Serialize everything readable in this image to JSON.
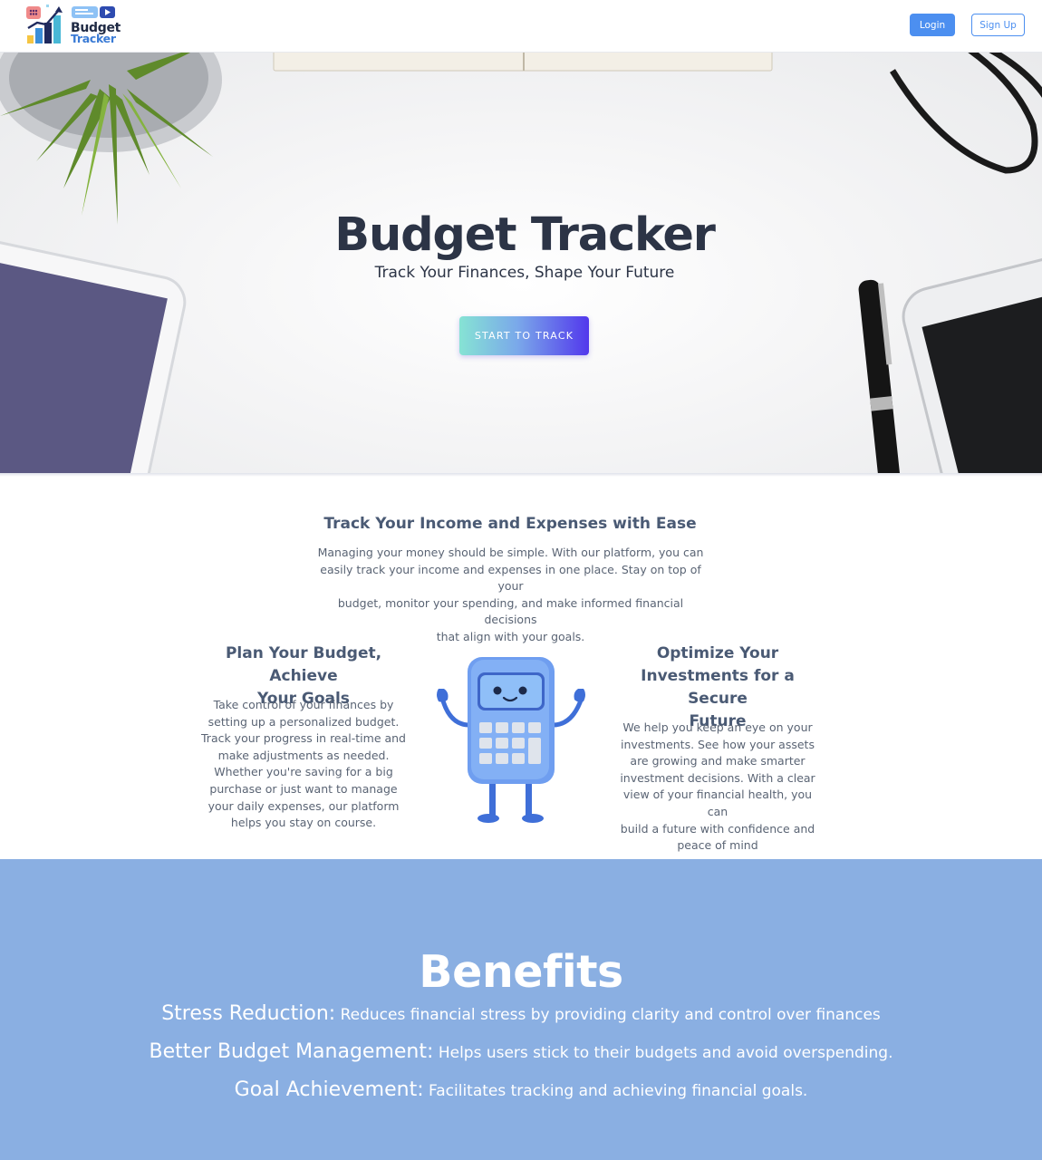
{
  "brand": {
    "line1": "Budget",
    "line2": "Tracker"
  },
  "header": {
    "login_label": "Login",
    "signup_label": "Sign Up"
  },
  "hero": {
    "title": "Budget Tracker",
    "subtitle": "Track Your Finances, Shape Your Future",
    "cta_label": "START TO TRACK"
  },
  "intro": {
    "heading": "Track Your Income and Expenses with Ease",
    "lines": [
      "Managing your money should be simple. With our platform, you can",
      "easily track your income and expenses in one place. Stay on top of your",
      "budget, monitor your spending, and make informed financial decisions",
      "that align with your goals."
    ]
  },
  "plan": {
    "heading_lines": [
      "Plan Your Budget, Achieve",
      "Your Goals"
    ],
    "lines": [
      "Take control of your finances by",
      "setting up a personalized budget.",
      "Track your progress in real-time and",
      "make adjustments as needed.",
      "Whether you're saving for a big",
      "purchase or just want to manage",
      "your daily expenses, our platform",
      "helps you stay on course."
    ]
  },
  "invest": {
    "heading_lines": [
      "Optimize Your",
      "Investments for a Secure",
      "Future"
    ],
    "lines": [
      "We help you keep an eye on your",
      "investments. See how your assets",
      "are growing and make smarter",
      "investment decisions. With a clear",
      "view of your financial health, you can",
      "build a future with confidence and",
      "peace of mind"
    ]
  },
  "benefits": {
    "title": "Benefits",
    "items": [
      {
        "key": "Stress Reduction:",
        "value": " Reduces financial stress by providing clarity and control over finances"
      },
      {
        "key": "Better Budget Management:",
        "value": " Helps users stick to their budgets and avoid overspending."
      },
      {
        "key": "Goal Achievement:",
        "value": " Facilitates tracking and achieving financial goals."
      }
    ]
  },
  "colors": {
    "accent": "#4c8ff0",
    "heading": "#2c3446",
    "benefits_bg": "#8aafe2",
    "cta_gradient": [
      "#86e3d4",
      "#7aa8ea",
      "#5238ec"
    ]
  }
}
